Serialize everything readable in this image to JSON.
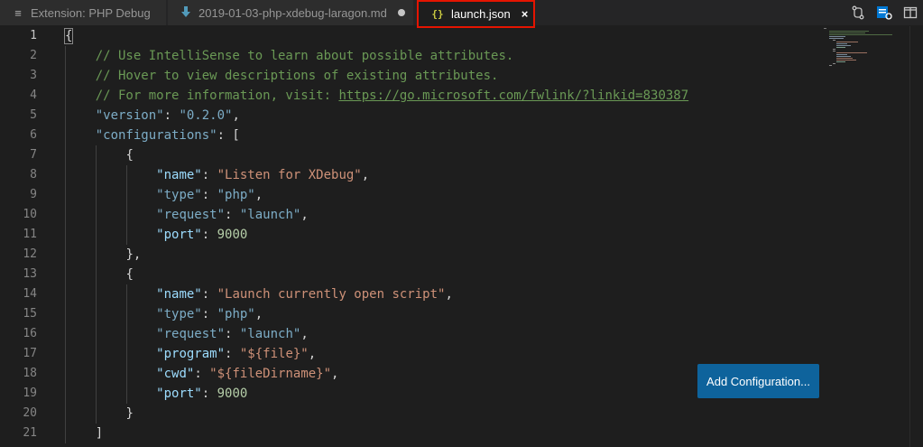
{
  "tabs": [
    {
      "label": "Extension: PHP Debug",
      "icon": "menu-lines-icon",
      "active": false
    },
    {
      "label": "2019-01-03-php-xdebug-laragon.md",
      "icon": "download-arrow-icon",
      "active": false,
      "dirty": true
    },
    {
      "label": "launch.json",
      "icon": "json-braces-icon",
      "icon_glyph": "{}",
      "active": true,
      "close": "×"
    }
  ],
  "actions": [
    "open-changes-icon",
    "open-preview-icon",
    "split-editor-icon"
  ],
  "editor": {
    "active_line": 1,
    "line_numbers": [
      "1",
      "2",
      "3",
      "4",
      "5",
      "6",
      "7",
      "8",
      "9",
      "10",
      "11",
      "12",
      "13",
      "14",
      "15",
      "16",
      "17",
      "18",
      "19",
      "20",
      "21"
    ],
    "lines": {
      "l1": "{",
      "l2": "// Use IntelliSense to learn about possible attributes.",
      "l3": "// Hover to view descriptions of existing attributes.",
      "l4_prefix": "// For more information, visit: ",
      "l4_link": "https://go.microsoft.com/fwlink/?linkid=830387",
      "l5_key": "\"version\"",
      "l5_val": "\"0.2.0\"",
      "l6_key": "\"configurations\"",
      "l6_rest": ": [",
      "l7": "{",
      "l8_key": "\"name\"",
      "l8_val": "\"Listen for XDebug\"",
      "l9_key": "\"type\"",
      "l9_val": "\"php\"",
      "l10_key": "\"request\"",
      "l10_val": "\"launch\"",
      "l11_key": "\"port\"",
      "l11_val": "9000",
      "l12": "},",
      "l13": "{",
      "l14_key": "\"name\"",
      "l14_val": "\"Launch currently open script\"",
      "l15_key": "\"type\"",
      "l15_val": "\"php\"",
      "l16_key": "\"request\"",
      "l16_val": "\"launch\"",
      "l17_key": "\"program\"",
      "l17_val": "\"${file}\"",
      "l18_key": "\"cwd\"",
      "l18_val": "\"${fileDirname}\"",
      "l19_key": "\"port\"",
      "l19_val": "9000",
      "l20": "}",
      "l21": "]"
    }
  },
  "add_configuration_button": "Add Configuration...",
  "colors": {
    "tab_highlight_border": "#e51400",
    "button_bg": "#0e639c",
    "comment": "#6a9955",
    "string": "#ce9178",
    "number": "#b5cea8",
    "key": "#9cdcfe"
  }
}
